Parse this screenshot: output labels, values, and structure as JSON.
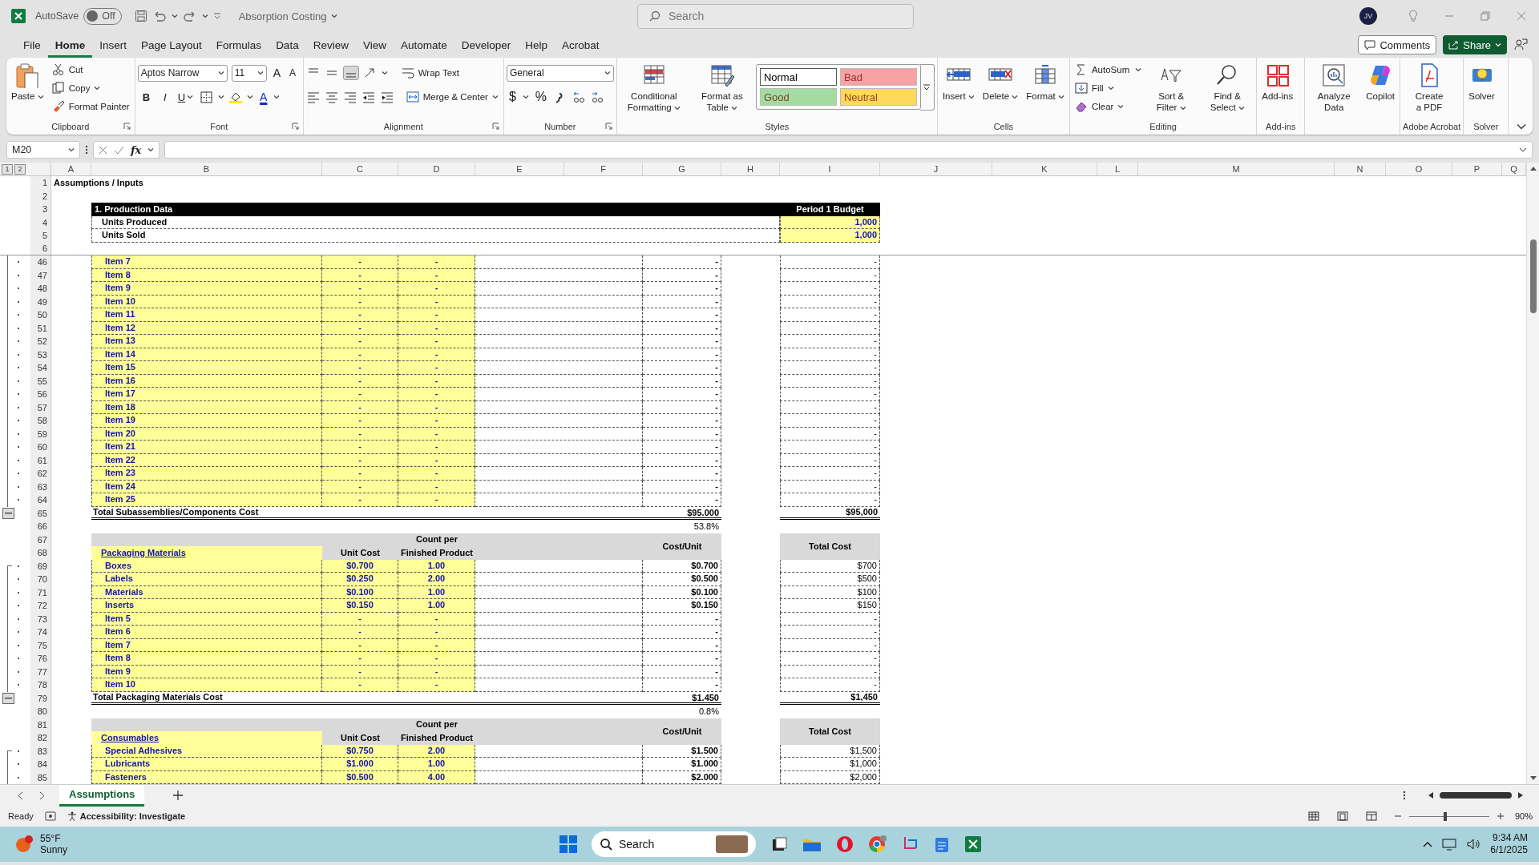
{
  "title_bar": {
    "autosave_label": "AutoSave",
    "autosave_on": false,
    "autosave_state": "Off",
    "document_title": "Absorption Costing",
    "search_placeholder": "Search",
    "avatar_initials": "JV"
  },
  "menu_tabs": [
    {
      "label": "File",
      "selected": false
    },
    {
      "label": "Home",
      "selected": true
    },
    {
      "label": "Insert",
      "selected": false
    },
    {
      "label": "Page Layout",
      "selected": false
    },
    {
      "label": "Formulas",
      "selected": false
    },
    {
      "label": "Data",
      "selected": false
    },
    {
      "label": "Review",
      "selected": false
    },
    {
      "label": "View",
      "selected": false
    },
    {
      "label": "Automate",
      "selected": false
    },
    {
      "label": "Developer",
      "selected": false
    },
    {
      "label": "Help",
      "selected": false
    },
    {
      "label": "Acrobat",
      "selected": false
    }
  ],
  "comments_button": "Comments",
  "share_button": "Share",
  "ribbon": {
    "groups": [
      {
        "kind": "clipboard",
        "label": "Clipboard",
        "paste": "Paste",
        "cut": "Cut",
        "copy": "Copy",
        "format_painter": "Format Painter"
      },
      {
        "kind": "font",
        "label": "Font",
        "font_name": "Aptos Narrow",
        "font_size": "11",
        "grow": "A",
        "shrink": "A",
        "bold": "B",
        "italic": "I",
        "underline": "U",
        "font_color": "A"
      },
      {
        "kind": "alignment",
        "label": "Alignment",
        "wrap_text": "Wrap Text",
        "merge_center": "Merge & Center"
      },
      {
        "kind": "number",
        "label": "Number",
        "format": "General",
        "currency": "$",
        "percent": "%"
      },
      {
        "kind": "styles",
        "label": "Styles",
        "conditional_formatting": "Conditional Formatting",
        "format_as_table": "Format as Table",
        "cell_styles": [
          {
            "label": "Normal",
            "color": "#ffffff"
          },
          {
            "label": "Bad",
            "color": "#f8a3a3"
          },
          {
            "label": "Good",
            "color": "#a3dc9e"
          },
          {
            "label": "Neutral",
            "color": "#ffd95c"
          }
        ]
      },
      {
        "kind": "cells",
        "label": "Cells",
        "buttons": [
          "Insert",
          "Delete",
          "Format"
        ]
      },
      {
        "kind": "editing",
        "label": "Editing",
        "autosum": "AutoSum",
        "fill": "Fill",
        "clear": "Clear",
        "sort_filter": "Sort & Filter",
        "find_select": "Find & Select"
      },
      {
        "kind": "addins",
        "label": "Add-ins",
        "button": "Add-ins"
      },
      {
        "kind": "analysis",
        "buttons": [
          "Analyze Data",
          "Copilot"
        ]
      },
      {
        "kind": "acrobat",
        "label": "Adobe Acrobat",
        "button": "Create a PDF"
      },
      {
        "kind": "solver",
        "label": "Solver",
        "button": "Solver"
      }
    ]
  },
  "formula_bar": {
    "name_box": "M20",
    "function_label": "fx"
  },
  "sheet": {
    "outline_levels": [
      "1",
      "2"
    ],
    "columns": [
      "A",
      "B",
      "C",
      "D",
      "E",
      "F",
      "G",
      "H",
      "I",
      "J",
      "K",
      "L",
      "M",
      "N",
      "O",
      "P",
      "Q"
    ],
    "rows": [
      {
        "kind": "title",
        "row": "1",
        "text": "Assumptions / Inputs"
      },
      {
        "kind": "blank",
        "row": "2"
      },
      {
        "kind": "band",
        "row": "3",
        "label": "1. Production Data",
        "period": "Period 1 Budget"
      },
      {
        "kind": "unit",
        "row": "4",
        "label": "Units Produced",
        "value": "1,000"
      },
      {
        "kind": "unit",
        "row": "5",
        "label": "Units Sold",
        "value": "1,000"
      },
      {
        "kind": "blank",
        "row": "6",
        "freeze": true
      },
      {
        "kind": "item",
        "row": "46",
        "outline": {
          "kind": "detail"
        },
        "name": "Item 7",
        "unit_cost": "-",
        "count": "-",
        "cost_unit": "-",
        "total": "-"
      },
      {
        "kind": "item",
        "row": "47",
        "outline": {
          "kind": "detail"
        },
        "name": "Item 8",
        "unit_cost": "-",
        "count": "-",
        "cost_unit": "-",
        "total": "-"
      },
      {
        "kind": "item",
        "row": "48",
        "outline": {
          "kind": "detail"
        },
        "name": "Item 9",
        "unit_cost": "-",
        "count": "-",
        "cost_unit": "-",
        "total": "-"
      },
      {
        "kind": "item",
        "row": "49",
        "outline": {
          "kind": "detail"
        },
        "name": "Item 10",
        "unit_cost": "-",
        "count": "-",
        "cost_unit": "-",
        "total": "-"
      },
      {
        "kind": "item",
        "row": "50",
        "outline": {
          "kind": "detail"
        },
        "name": "Item 11",
        "unit_cost": "-",
        "count": "-",
        "cost_unit": "-",
        "total": "-"
      },
      {
        "kind": "item",
        "row": "51",
        "outline": {
          "kind": "detail"
        },
        "name": "Item 12",
        "unit_cost": "-",
        "count": "-",
        "cost_unit": "-",
        "total": "-"
      },
      {
        "kind": "item",
        "row": "52",
        "outline": {
          "kind": "detail"
        },
        "name": "Item 13",
        "unit_cost": "-",
        "count": "-",
        "cost_unit": "-",
        "total": "-"
      },
      {
        "kind": "item",
        "row": "53",
        "outline": {
          "kind": "detail"
        },
        "name": "Item 14",
        "unit_cost": "-",
        "count": "-",
        "cost_unit": "-",
        "total": "-"
      },
      {
        "kind": "item",
        "row": "54",
        "outline": {
          "kind": "detail"
        },
        "name": "Item 15",
        "unit_cost": "-",
        "count": "-",
        "cost_unit": "-",
        "total": "-"
      },
      {
        "kind": "item",
        "row": "55",
        "outline": {
          "kind": "detail"
        },
        "name": "Item 16",
        "unit_cost": "-",
        "count": "-",
        "cost_unit": "-",
        "total": "-"
      },
      {
        "kind": "item",
        "row": "56",
        "outline": {
          "kind": "detail"
        },
        "name": "Item 17",
        "unit_cost": "-",
        "count": "-",
        "cost_unit": "-",
        "total": "-"
      },
      {
        "kind": "item",
        "row": "57",
        "outline": {
          "kind": "detail"
        },
        "name": "Item 18",
        "unit_cost": "-",
        "count": "-",
        "cost_unit": "-",
        "total": "-"
      },
      {
        "kind": "item",
        "row": "58",
        "outline": {
          "kind": "detail"
        },
        "name": "Item 19",
        "unit_cost": "-",
        "count": "-",
        "cost_unit": "-",
        "total": "-"
      },
      {
        "kind": "item",
        "row": "59",
        "outline": {
          "kind": "detail"
        },
        "name": "Item 20",
        "unit_cost": "-",
        "count": "-",
        "cost_unit": "-",
        "total": "-"
      },
      {
        "kind": "item",
        "row": "60",
        "outline": {
          "kind": "detail"
        },
        "name": "Item 21",
        "unit_cost": "-",
        "count": "-",
        "cost_unit": "-",
        "total": "-"
      },
      {
        "kind": "item",
        "row": "61",
        "outline": {
          "kind": "detail"
        },
        "name": "Item 22",
        "unit_cost": "-",
        "count": "-",
        "cost_unit": "-",
        "total": "-"
      },
      {
        "kind": "item",
        "row": "62",
        "outline": {
          "kind": "detail"
        },
        "name": "Item 23",
        "unit_cost": "-",
        "count": "-",
        "cost_unit": "-",
        "total": "-"
      },
      {
        "kind": "item",
        "row": "63",
        "outline": {
          "kind": "detail"
        },
        "name": "Item 24",
        "unit_cost": "-",
        "count": "-",
        "cost_unit": "-",
        "total": "-"
      },
      {
        "kind": "item",
        "row": "64",
        "outline": {
          "kind": "detail"
        },
        "name": "Item 25",
        "unit_cost": "-",
        "count": "-",
        "cost_unit": "-",
        "total": "-"
      },
      {
        "kind": "total",
        "row": "65",
        "outline": {
          "kind": "collapse"
        },
        "label": "Total Subassemblies/Components Cost",
        "cost_unit": "$95.000",
        "total": "$95,000"
      },
      {
        "kind": "share",
        "row": "66",
        "share": "53.8%"
      },
      {
        "kind": "header",
        "rows": [
          "67",
          "68"
        ],
        "section": "Packaging Materials",
        "unit_cost_label": "Unit Cost",
        "count_label_top": "Count per",
        "count_label": "Finished Product",
        "cost_unit_label": "Cost/Unit",
        "total_label": "Total Cost"
      },
      {
        "kind": "item",
        "row": "69",
        "outline": {
          "kind": "start"
        },
        "name": "Boxes",
        "unit_cost": "$0.700",
        "count": "1.00",
        "cost_unit": "$0.700",
        "total": "$700"
      },
      {
        "kind": "item",
        "row": "70",
        "outline": {
          "kind": "detail"
        },
        "name": "Labels",
        "unit_cost": "$0.250",
        "count": "2.00",
        "cost_unit": "$0.500",
        "total": "$500"
      },
      {
        "kind": "item",
        "row": "71",
        "outline": {
          "kind": "detail"
        },
        "name": "Materials",
        "unit_cost": "$0.100",
        "count": "1.00",
        "cost_unit": "$0.100",
        "total": "$100"
      },
      {
        "kind": "item",
        "row": "72",
        "outline": {
          "kind": "detail"
        },
        "name": "Inserts",
        "unit_cost": "$0.150",
        "count": "1.00",
        "cost_unit": "$0.150",
        "total": "$150"
      },
      {
        "kind": "item",
        "row": "73",
        "outline": {
          "kind": "detail"
        },
        "name": "Item 5",
        "unit_cost": "-",
        "count": "-",
        "cost_unit": "-",
        "total": "-"
      },
      {
        "kind": "item",
        "row": "74",
        "outline": {
          "kind": "detail"
        },
        "name": "Item 6",
        "unit_cost": "-",
        "count": "-",
        "cost_unit": "-",
        "total": "-"
      },
      {
        "kind": "item",
        "row": "75",
        "outline": {
          "kind": "detail"
        },
        "name": "Item 7",
        "unit_cost": "-",
        "count": "-",
        "cost_unit": "-",
        "total": "-"
      },
      {
        "kind": "item",
        "row": "76",
        "outline": {
          "kind": "detail"
        },
        "name": "Item 8",
        "unit_cost": "-",
        "count": "-",
        "cost_unit": "-",
        "total": "-"
      },
      {
        "kind": "item",
        "row": "77",
        "outline": {
          "kind": "detail"
        },
        "name": "Item 9",
        "unit_cost": "-",
        "count": "-",
        "cost_unit": "-",
        "total": "-"
      },
      {
        "kind": "item",
        "row": "78",
        "outline": {
          "kind": "detail"
        },
        "name": "Item 10",
        "unit_cost": "-",
        "count": "-",
        "cost_unit": "-",
        "total": "-"
      },
      {
        "kind": "total",
        "row": "79",
        "outline": {
          "kind": "collapse"
        },
        "label": "Total Packaging Materials Cost",
        "cost_unit": "$1.450",
        "total": "$1,450"
      },
      {
        "kind": "share",
        "row": "80",
        "share": "0.8%"
      },
      {
        "kind": "header",
        "rows": [
          "81",
          "82"
        ],
        "section": "Consumables",
        "unit_cost_label": "Unit Cost",
        "count_label_top": "Count per",
        "count_label": "Finished Product",
        "cost_unit_label": "Cost/Unit",
        "total_label": "Total Cost"
      },
      {
        "kind": "item",
        "row": "83",
        "outline": {
          "kind": "start"
        },
        "name": "Special Adhesives",
        "unit_cost": "$0.750",
        "count": "2.00",
        "cost_unit": "$1.500",
        "total": "$1,500"
      },
      {
        "kind": "item",
        "row": "84",
        "outline": {
          "kind": "detail"
        },
        "name": "Lubricants",
        "unit_cost": "$1.000",
        "count": "1.00",
        "cost_unit": "$1.000",
        "total": "$1,000"
      },
      {
        "kind": "item",
        "row": "85",
        "outline": {
          "kind": "detail"
        },
        "name": "Fasteners",
        "unit_cost": "$0.500",
        "count": "4.00",
        "cost_unit": "$2.000",
        "total": "$2,000"
      }
    ]
  },
  "sheet_tabs": [
    {
      "label": "Assumptions",
      "selected": true
    }
  ],
  "status_bar": {
    "ready": "Ready",
    "accessibility": "Accessibility: Investigate",
    "zoom_slider": {
      "level": 0.45
    },
    "zoom": "90%"
  },
  "taskbar": {
    "temperature": "55°F",
    "weather": "Sunny",
    "search": "Search",
    "time": "9:34 AM",
    "date": "6/1/2025"
  }
}
